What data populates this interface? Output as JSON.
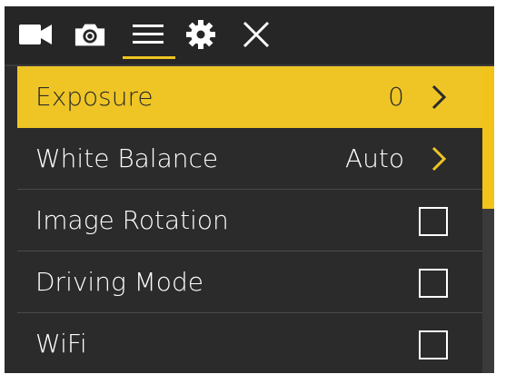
{
  "toolbar": {
    "icons": [
      "video-camera-icon",
      "photo-camera-icon",
      "menu-icon",
      "settings-gear-icon",
      "close-icon"
    ],
    "active_tab": "menu"
  },
  "menu": {
    "items": [
      {
        "label": "Exposure",
        "value": "0",
        "control": "chevron",
        "selected": true
      },
      {
        "label": "White Balance",
        "value": "Auto",
        "control": "chevron",
        "selected": false
      },
      {
        "label": "Image Rotation",
        "value": "",
        "control": "checkbox",
        "checked": false
      },
      {
        "label": "Driving Mode",
        "value": "",
        "control": "checkbox",
        "checked": false
      },
      {
        "label": "WiFi",
        "value": "",
        "control": "checkbox",
        "checked": false
      }
    ]
  },
  "scrollbar": {
    "position_fraction": 0.0,
    "visible_fraction": 0.46
  },
  "colors": {
    "accent": "#eec525",
    "background": "#2b2b2b",
    "text": "#ffffff"
  }
}
